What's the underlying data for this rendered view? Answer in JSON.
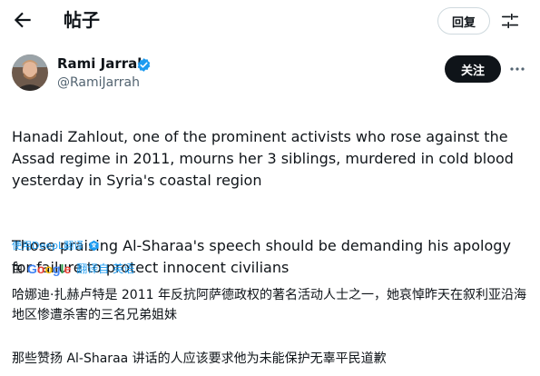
{
  "header": {
    "title": "帖子",
    "reply_label": "回复"
  },
  "author": {
    "name": "Rami Jarrah",
    "handle": "@RamiJarrah",
    "follow_label": "关注"
  },
  "tweet": {
    "paragraph1": "Hanadi Zahlout, one of the prominent activists who rose against the Assad regime in 2011, mourns her 3 siblings, murdered in cold blood yesterday in Syria's coastal region",
    "paragraph2": "Those praising Al-Sharaa's speech should be demanding his apology for failure to protect innocent civilians"
  },
  "translation": {
    "deepl_link": "使用DeepL翻译",
    "by_label": "由",
    "google_letters": [
      "G",
      "o",
      "o",
      "g",
      "l",
      "e"
    ],
    "translated_from": "翻译自 英语",
    "paragraph1": "哈娜迪·扎赫卢特是 2011 年反抗阿萨德政权的著名活动人士之一，她哀悼昨天在叙利亚沿海地区惨遭杀害的三名兄弟姐妹",
    "paragraph2": "那些赞扬 Al-Sharaa 讲话的人应该要求他为未能保护无辜平民道歉"
  },
  "icons": {
    "back": "arrow-left-icon",
    "tune": "tune-icon",
    "verified": "verified-badge-icon",
    "more": "more-horizontal-icon",
    "translate": "translate-icon"
  },
  "colors": {
    "accent": "#1d9bf0",
    "text": "#0f1419",
    "secondary": "#536471",
    "follow_bg": "#0f1419"
  }
}
